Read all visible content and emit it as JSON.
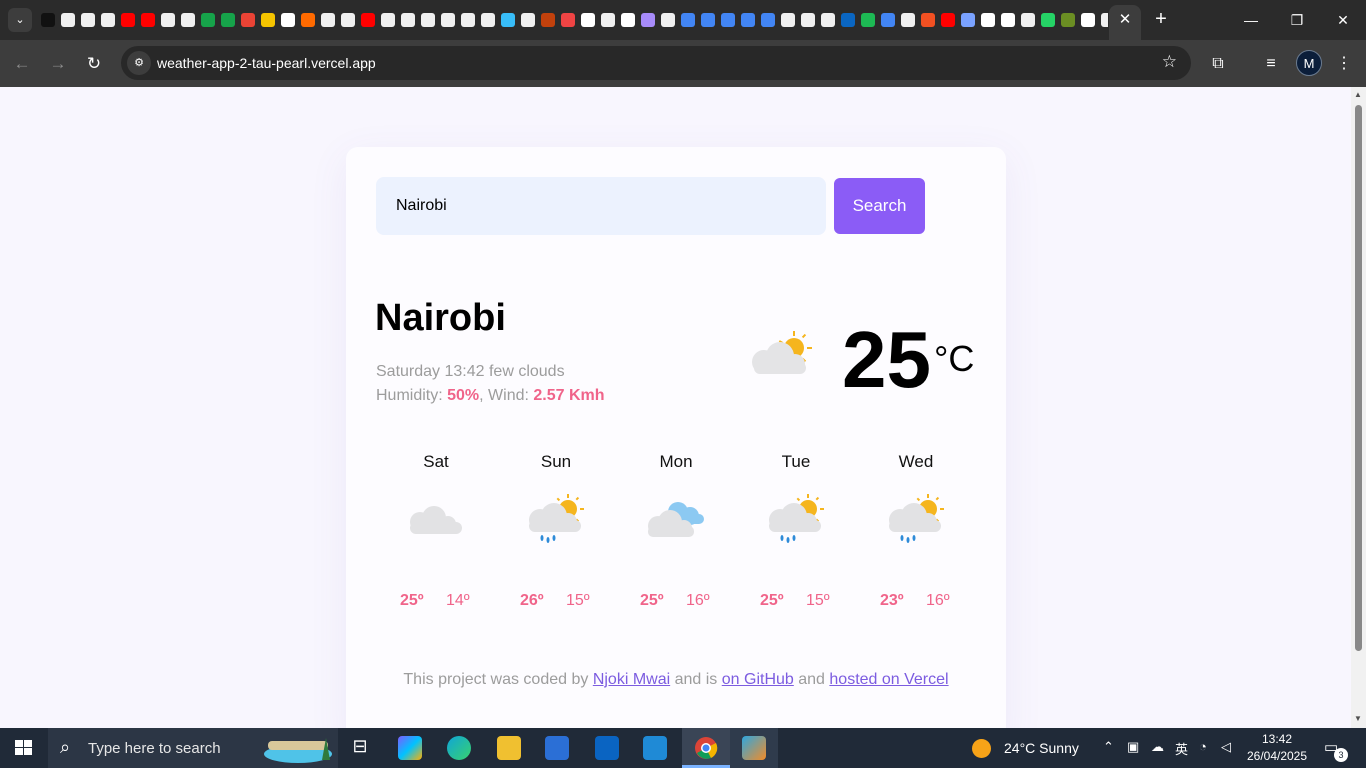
{
  "browser": {
    "url": "weather-app-2-tau-pearl.vercel.app",
    "bookmark_colors": [
      "#111111",
      "#f0f0f0",
      "#f0f0f0",
      "#f0f0f0",
      "#ff0000",
      "#ff0000",
      "#f0f0f0",
      "#f0f0f0",
      "#16a34a",
      "#16a34a",
      "#ea4335",
      "#f5c400",
      "#ffffff",
      "#ff6a00",
      "#f0f0f0",
      "#f0f0f0",
      "#ff0000",
      "#f0f0f0",
      "#f0f0f0",
      "#f0f0f0",
      "#f0f0f0",
      "#f0f0f0",
      "#f0f0f0",
      "#38bdf8",
      "#f0f0f0",
      "#c2410c",
      "#ef4444",
      "#ffffff",
      "#f0f0f0",
      "#ffffff",
      "#a78bfa",
      "#f0f0f0",
      "#4285f4",
      "#4285f4",
      "#4285f4",
      "#4285f4",
      "#4285f4",
      "#f0f0f0",
      "#f0f0f0",
      "#f0f0f0",
      "#0a66c2",
      "#1db954",
      "#4285f4",
      "#f0f0f0",
      "#f25022",
      "#ff0000",
      "#7aa2ff",
      "#ffffff",
      "#ffffff",
      "#f0f0f0",
      "#25d366",
      "#6b8e23",
      "#ffffff",
      "#f0f0f0",
      "#ff9a3c",
      "#f0f0f0"
    ],
    "profile_initial": "M"
  },
  "weather": {
    "search_value": "Nairobi",
    "search_button": "Search",
    "city": "Nairobi",
    "datetime": "Saturday 13:42",
    "description": "few clouds",
    "humidity_label": "Humidity: ",
    "humidity": "50%",
    "sep": ", ",
    "wind_label": "Wind: ",
    "wind": "2.57 Kmh",
    "temperature": "25",
    "unit": "°C",
    "current_icon": "partly-cloudy-icon",
    "forecast": [
      {
        "day": "Sat",
        "icon": "cloudy-icon",
        "max": "25º",
        "min": "14º"
      },
      {
        "day": "Sun",
        "icon": "sun-rain-icon",
        "max": "26º",
        "min": "15º"
      },
      {
        "day": "Mon",
        "icon": "broken-clouds-icon",
        "max": "25º",
        "min": "16º"
      },
      {
        "day": "Tue",
        "icon": "sun-rain-icon",
        "max": "25º",
        "min": "15º"
      },
      {
        "day": "Wed",
        "icon": "sun-rain-icon",
        "max": "23º",
        "min": "16º"
      }
    ],
    "footer": {
      "t1": "This project was coded by ",
      "author": "Njoki Mwai",
      "t2": " and is ",
      "github": "on GitHub",
      "t3": " and ",
      "vercel": "hosted on Vercel"
    }
  },
  "taskbar": {
    "search_placeholder": "Type here to search",
    "weather_temp": "24°C",
    "weather_condition": "Sunny",
    "weather_text": "24°C  Sunny",
    "ime": "英",
    "time": "13:42",
    "date": "26/04/2025",
    "notification_count": "3",
    "colors": {
      "accent": "#8b5cf6",
      "highlight": "#f0648a",
      "link": "#7c5ce0"
    }
  }
}
